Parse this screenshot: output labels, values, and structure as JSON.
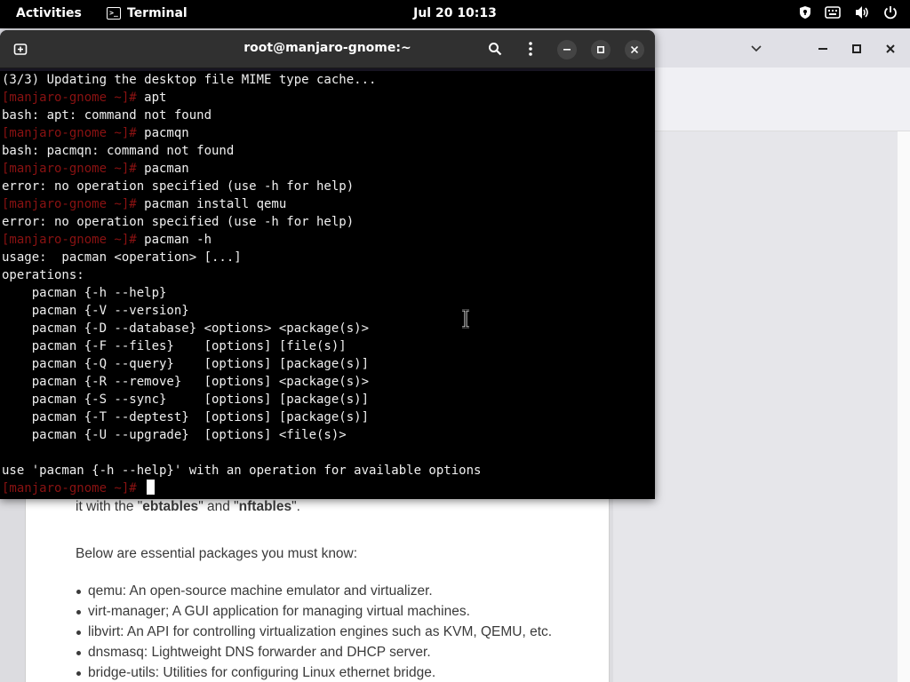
{
  "topbar": {
    "activities": "Activities",
    "app_name": "Terminal",
    "app_icon_text": ">_",
    "clock": "Jul 20  10:13",
    "tray_icons": [
      "shield-icon",
      "keyboard-icon",
      "volume-icon",
      "power-icon"
    ]
  },
  "terminal": {
    "title": "root@manjaro-gnome:~",
    "prompt": "[manjaro-gnome ~]#",
    "lines": [
      {
        "type": "out",
        "text": "(3/3) Updating the desktop file MIME type cache..."
      },
      {
        "type": "cmd",
        "text": " apt"
      },
      {
        "type": "out",
        "text": "bash: apt: command not found"
      },
      {
        "type": "cmd",
        "text": " pacmqn"
      },
      {
        "type": "out",
        "text": "bash: pacmqn: command not found"
      },
      {
        "type": "cmd",
        "text": " pacman"
      },
      {
        "type": "out",
        "text": "error: no operation specified (use -h for help)"
      },
      {
        "type": "cmd",
        "text": " pacman install qemu"
      },
      {
        "type": "out",
        "text": "error: no operation specified (use -h for help)"
      },
      {
        "type": "cmd",
        "text": " pacman -h"
      },
      {
        "type": "out",
        "text": "usage:  pacman <operation> [...]"
      },
      {
        "type": "out",
        "text": "operations:"
      },
      {
        "type": "out",
        "text": "    pacman {-h --help}"
      },
      {
        "type": "out",
        "text": "    pacman {-V --version}"
      },
      {
        "type": "out",
        "text": "    pacman {-D --database} <options> <package(s)>"
      },
      {
        "type": "out",
        "text": "    pacman {-F --files}    [options] [file(s)]"
      },
      {
        "type": "out",
        "text": "    pacman {-Q --query}    [options] [package(s)]"
      },
      {
        "type": "out",
        "text": "    pacman {-R --remove}   [options] <package(s)>"
      },
      {
        "type": "out",
        "text": "    pacman {-S --sync}     [options] [package(s)]"
      },
      {
        "type": "out",
        "text": "    pacman {-T --deptest}  [options] [package(s)]"
      },
      {
        "type": "out",
        "text": "    pacman {-U --upgrade}  [options] <file(s)>"
      },
      {
        "type": "out",
        "text": ""
      },
      {
        "type": "out",
        "text": "use 'pacman {-h --help}' with an operation for available options"
      },
      {
        "type": "cmd",
        "text": " ",
        "cursor": true
      }
    ]
  },
  "article": {
    "line1_pre": "it with the \"",
    "line1_b1": "ebtables",
    "line1_mid": "\" and \"",
    "line1_b2": "nftables",
    "line1_post": "\".",
    "intro": "Below are essential packages you must know:",
    "items": [
      "qemu: An open-source machine emulator and virtualizer.",
      "virt-manager; A GUI application for managing virtual machines.",
      "libvirt: An API for controlling virtualization engines such as KVM, QEMU, etc.",
      "dnsmasq: Lightweight DNS forwarder and DHCP server.",
      "bridge-utils: Utilities for configuring Linux ethernet bridge."
    ]
  },
  "colors": {
    "prompt": "#8a1212",
    "terminal_bg": "#000000",
    "headerbar": "#303030"
  }
}
